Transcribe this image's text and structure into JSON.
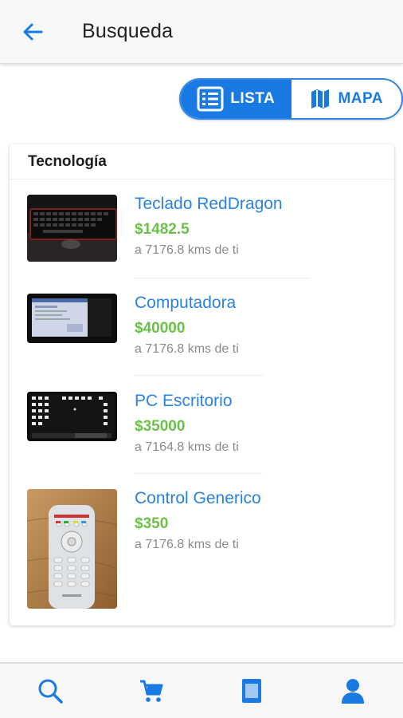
{
  "app_bar": {
    "title": "Busqueda",
    "back_icon": "arrow-left-icon"
  },
  "view_toggle": {
    "list_label": "LISTA",
    "map_label": "MAPA",
    "selected": "LISTA",
    "list_icon": "list-icon",
    "map_icon": "map-icon"
  },
  "section": {
    "title": "Tecnología",
    "items": [
      {
        "name": "Teclado RedDragon",
        "price": "$1482.5",
        "distance": "a 7176.8 kms de ti",
        "image": "keyboard-photo"
      },
      {
        "name": "Computadora",
        "price": "$40000",
        "distance": "a 7176.8 kms de ti",
        "image": "computer-screen-photo"
      },
      {
        "name": "PC Escritorio",
        "price": "$35000",
        "distance": "a 7164.8 kms de ti",
        "image": "desktop-screen-photo"
      },
      {
        "name": "Control Generico",
        "price": "$350",
        "distance": "a 7176.8 kms de ti",
        "image": "remote-control-photo"
      }
    ]
  },
  "bottom_nav": {
    "items": [
      "search-icon",
      "cart-icon",
      "catalog-icon",
      "profile-icon"
    ]
  },
  "colors": {
    "accent": "#1a7ae3",
    "link": "#2a82df",
    "price": "#6cc04a",
    "muted": "#8a8a8a"
  }
}
